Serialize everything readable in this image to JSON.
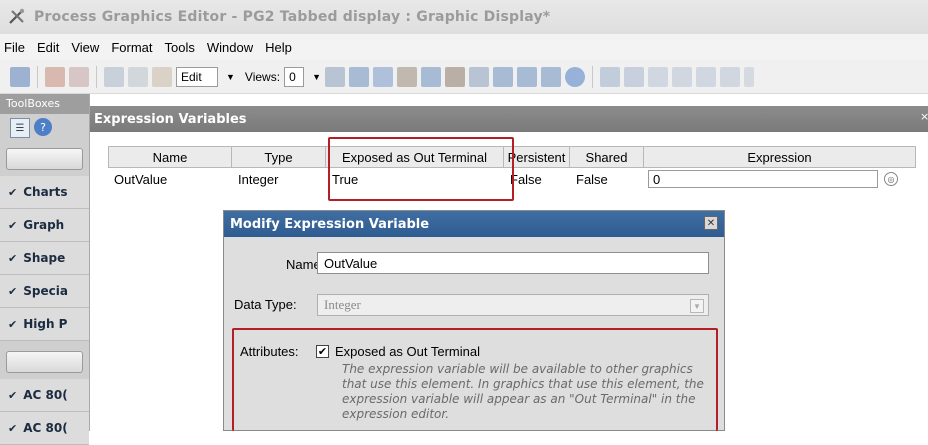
{
  "window": {
    "title": "Process Graphics Editor -  PG2 Tabbed display : Graphic Display*"
  },
  "menu": {
    "items": [
      "File",
      "Edit",
      "View",
      "Format",
      "Tools",
      "Window",
      "Help"
    ]
  },
  "toolbar": {
    "edit_combo": "Edit",
    "views_label": "Views:",
    "views_value": "0"
  },
  "toolbox": {
    "title": "ToolBoxes",
    "categories": [
      "Charts",
      "Graph",
      "Shape",
      "Specia",
      "High P",
      "AC 80(",
      "AC 80("
    ]
  },
  "expression_variables": {
    "title": "Expression Variables",
    "columns": [
      "Name",
      "Type",
      "Exposed as Out Terminal",
      "Persistent",
      "Shared",
      "Expression"
    ],
    "rows": [
      {
        "name": "OutValue",
        "type": "Integer",
        "exposed": "True",
        "persistent": "False",
        "shared": "False",
        "expression": "0"
      }
    ]
  },
  "dialog": {
    "title": "Modify Expression Variable",
    "name_label": "Name:",
    "name_value": "OutValue",
    "datatype_label": "Data Type:",
    "datatype_value": "Integer",
    "attributes_label": "Attributes:",
    "checkbox_label": "Exposed as Out Terminal",
    "checkbox_checked": true,
    "description": "The expression variable will be available to other graphics that use this element. In graphics that use this element, the expression variable will appear as an \"Out Terminal\" in the expression editor."
  },
  "colors": {
    "highlight": "#b21f24",
    "dialog_title": "#3f6ea3",
    "panel_header": "#808080"
  }
}
